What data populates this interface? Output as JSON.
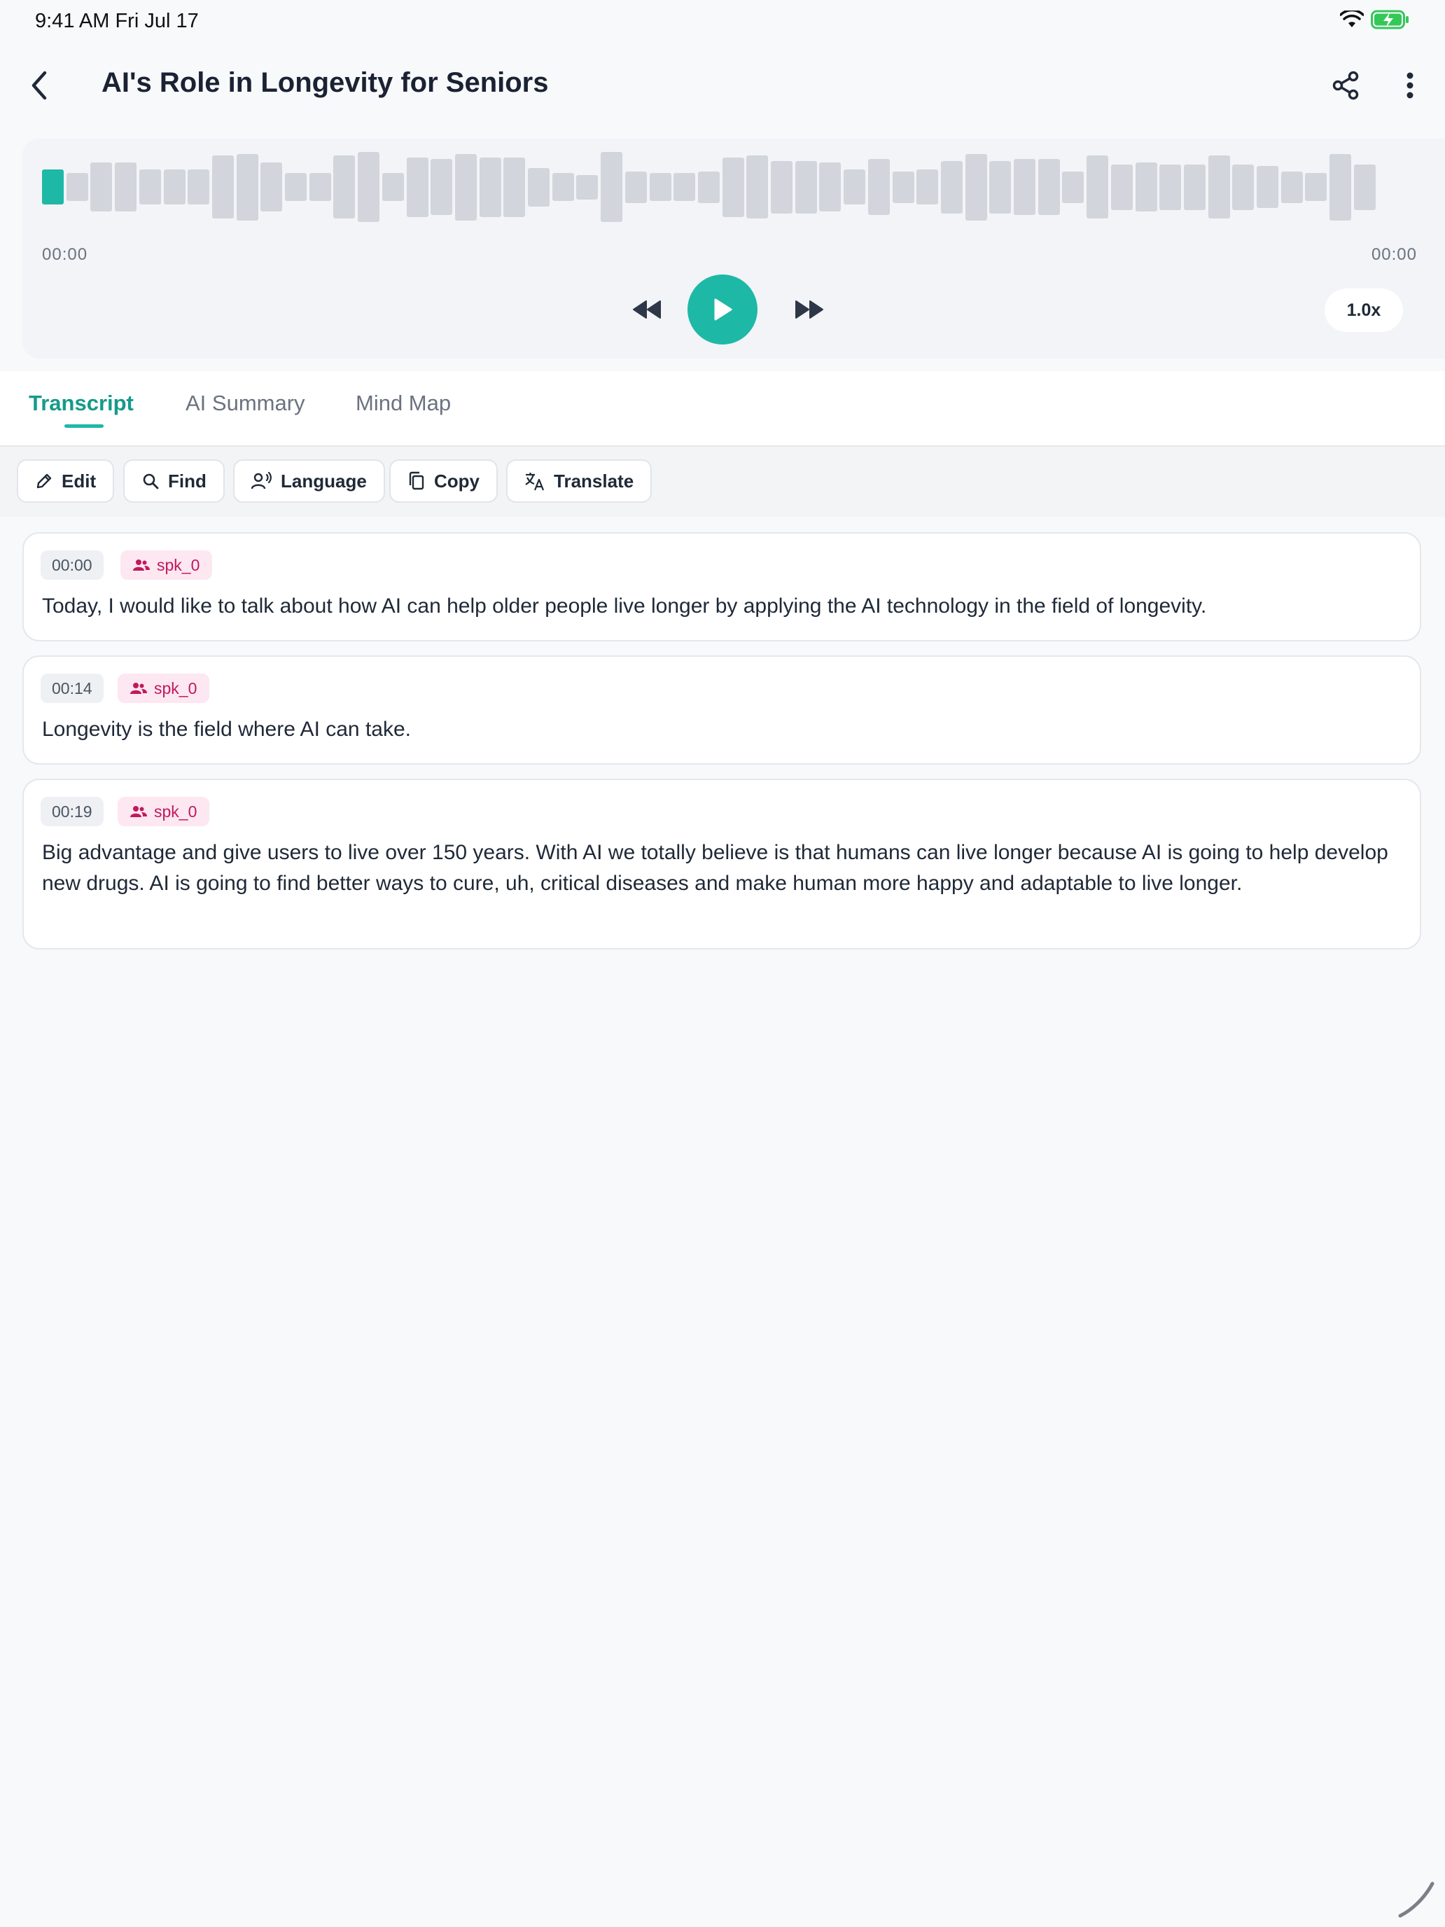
{
  "status": {
    "time": "9:41 AM  Fri Jul 17",
    "wifi_icon": "wifi-icon",
    "battery_icon": "battery-charging-icon",
    "battery_color": "#34c759"
  },
  "header": {
    "title": "AI's Role in Longevity for Seniors"
  },
  "player": {
    "time_start": "00:00",
    "time_end": "00:00",
    "speed": "1.0x",
    "progress": 0,
    "accent": "#1eb8a6",
    "waveform_levels": [
      0.5,
      0.4,
      0.7,
      0.7,
      0.5,
      0.5,
      0.5,
      0.9,
      0.95,
      0.7,
      0.4,
      0.4,
      0.9,
      1.0,
      0.4,
      0.85,
      0.8,
      0.95,
      0.85,
      0.85,
      0.55,
      0.4,
      0.35,
      1.0,
      0.45,
      0.4,
      0.4,
      0.45,
      0.85,
      0.9,
      0.75,
      0.75,
      0.7,
      0.5,
      0.8,
      0.45,
      0.5,
      0.75,
      0.95,
      0.75,
      0.8,
      0.8,
      0.45,
      0.9,
      0.65,
      0.7,
      0.65,
      0.65,
      0.9,
      0.65,
      0.6,
      0.45,
      0.4,
      0.95,
      0.65
    ]
  },
  "tabs": [
    {
      "label": "Transcript",
      "active": true
    },
    {
      "label": "AI Summary",
      "active": false
    },
    {
      "label": "Mind Map",
      "active": false
    }
  ],
  "toolbar": {
    "edit": "Edit",
    "find": "Find",
    "language": "Language",
    "copy": "Copy",
    "translate": "Translate"
  },
  "segments": [
    {
      "time": "00:00",
      "speaker": "spk_0",
      "text": "Today, I would like to talk about how AI can help older people live longer by applying the AI technology in the field of longevity."
    },
    {
      "time": "00:14",
      "speaker": "spk_0",
      "text": "Longevity is the field where AI can take."
    },
    {
      "time": "00:19",
      "speaker": "spk_0",
      "text": "Big advantage and give users to live over 150 years. With AI we totally believe is that humans can live longer because AI is going to help develop new drugs. AI is going to find better ways to cure, uh, critical diseases and make human more happy and adaptable to live longer."
    }
  ]
}
